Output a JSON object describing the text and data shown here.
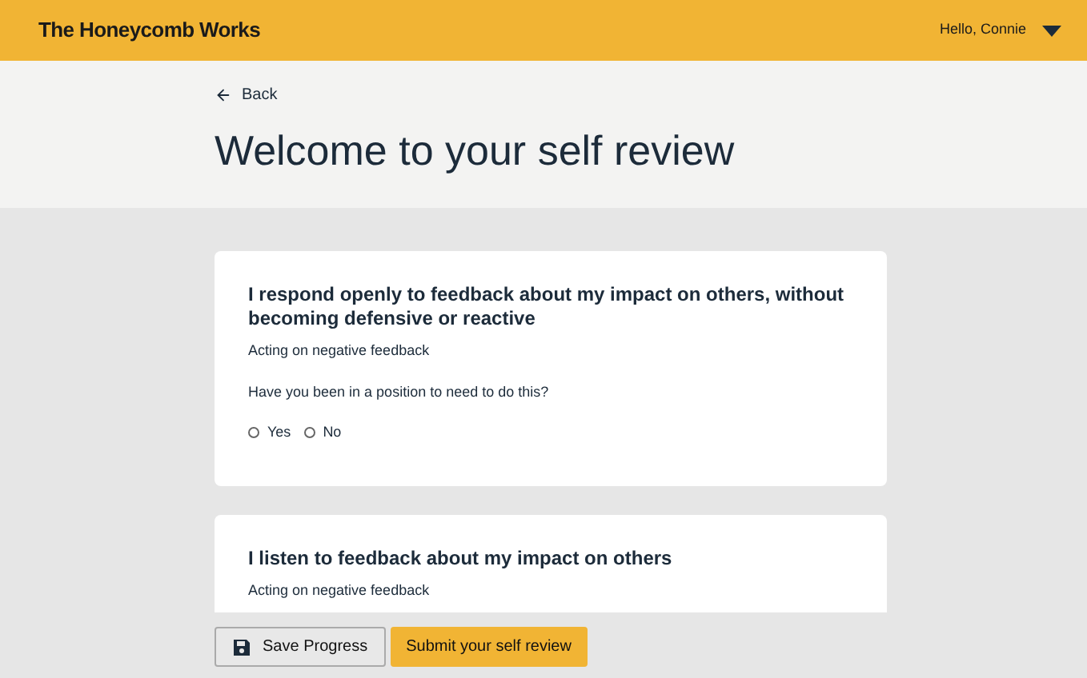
{
  "header": {
    "brand": "The Honeycomb Works",
    "greeting": "Hello, Connie"
  },
  "back_link": "Back",
  "title": "Welcome to your self review",
  "questions": [
    {
      "statement": "I respond openly to feedback about my impact on others, without becoming defensive or reactive",
      "category": "Acting on negative feedback",
      "prompt": "Have you been in a position to need to do this?",
      "options": [
        {
          "label": "Yes",
          "selected": false
        },
        {
          "label": "No",
          "selected": false
        }
      ]
    },
    {
      "statement": "I listen to feedback about my impact on others",
      "category": "Acting on negative feedback"
    }
  ],
  "buttons": {
    "save": "Save Progress",
    "submit": "Submit your self review"
  }
}
